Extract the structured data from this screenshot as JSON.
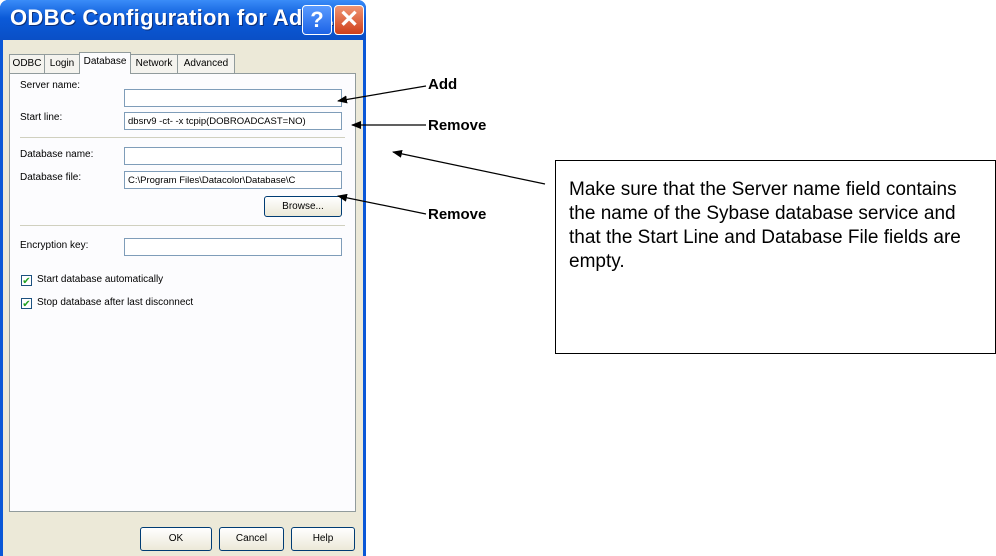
{
  "window": {
    "title": "ODBC Configuration for Ada...",
    "help_glyph": "?",
    "close_glyph": "✕"
  },
  "tabs": [
    "ODBC",
    "Login",
    "Database",
    "Network",
    "Advanced"
  ],
  "active_tab": "Database",
  "form": {
    "server_name_label": "Server name:",
    "server_name_value": "",
    "start_line_label": "Start line:",
    "start_line_value": "dbsrv9 -ct- -x tcpip(DOBROADCAST=NO)",
    "database_name_label": "Database name:",
    "database_name_value": "",
    "database_file_label": "Database file:",
    "database_file_value": "C:\\Program Files\\Datacolor\\Database\\C",
    "browse_label": "Browse...",
    "encryption_key_label": "Encryption key:",
    "encryption_key_value": "",
    "start_auto_label": "Start database automatically",
    "start_auto_checked": true,
    "stop_after_label": "Stop database after last disconnect",
    "stop_after_checked": true
  },
  "footer": {
    "ok_label": "OK",
    "cancel_label": "Cancel",
    "help_label": "Help"
  },
  "annotations": {
    "add_label": "Add",
    "remove_label_1": "Remove",
    "remove_label_2": "Remove",
    "note_text": "Make sure that the Server name field contains the name of the Sybase database service and that the Start Line and Database File fields are empty."
  },
  "colors": {
    "titlebar": "#0a57d7",
    "dialog_bg": "#ece9d8",
    "close_button": "#cf3f1a",
    "checkmark": "#21a121"
  }
}
